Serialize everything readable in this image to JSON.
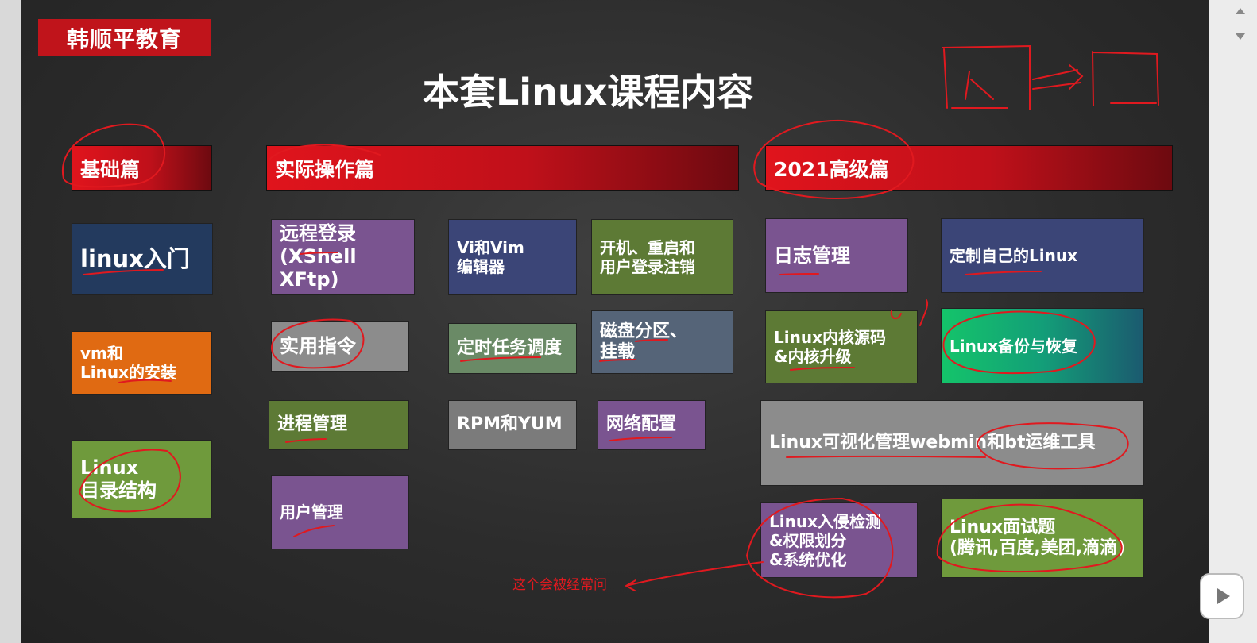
{
  "brand": "韩顺平教育",
  "title": "本套Linux课程内容",
  "sections": {
    "basic": "基础篇",
    "practical": "实际操作篇",
    "advanced": "2021高级篇"
  },
  "basic_items": [
    "linux入门",
    "vm和\nLinux的安装",
    "Linux\n目录结构"
  ],
  "practical_items": [
    "远程登录\n(XShell XFtp)",
    "Vi和Vim\n编辑器",
    "开机、重启和\n用户登录注销",
    "实用指令",
    "定时任务调度",
    "磁盘分区、\n挂载",
    "进程管理",
    "RPM和YUM",
    "网络配置",
    "用户管理"
  ],
  "advanced_items": [
    "日志管理",
    "定制自己的Linux",
    "Linux内核源码\n&内核升级",
    "Linux备份与恢复",
    "Linux可视化管理webmin和bt运维工具",
    "Linux入侵检测\n&权限划分\n&系统优化",
    "Linux面试题\n(腾讯,百度,美团,滴滴)"
  ],
  "annotation": "这个会被经常问",
  "colors": {
    "brand_red": "#c0141b",
    "navy": "#233a5e",
    "orange": "#e06a12",
    "olive": "#6f9a3c",
    "purple": "#7a5490",
    "slate_blue": "#3b4577",
    "moss": "#5d7a35",
    "gray": "#8c8c8c",
    "sage": "#6a8a66",
    "steel": "#556478",
    "ink_red": "#e0191f"
  }
}
